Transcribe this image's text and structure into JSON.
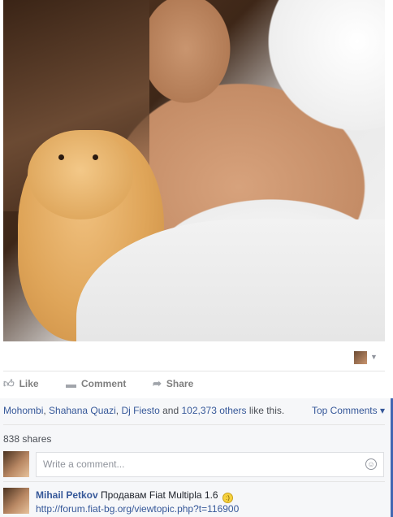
{
  "post": {
    "image_alt": "",
    "actions": {
      "like": "Like",
      "comment": "Comment",
      "share": "Share"
    },
    "icons": {
      "like": "thumbs-up-icon",
      "comment": "speech-bubble-icon",
      "share": "share-arrow-icon"
    }
  },
  "likes": {
    "names": [
      "Mohombi",
      "Shahana Quazi",
      "Dj Fiesto"
    ],
    "sep1": ", ",
    "sep2": " and ",
    "others": "102,373 others",
    "suffix": " like this.",
    "top_comments": "Top Comments ▾"
  },
  "shares": "838 shares",
  "comment_input": {
    "placeholder": "Write a comment..."
  },
  "comment": {
    "author": "Mihail Petkov",
    "text": "Продавам Fiat Multipla 1.6",
    "emoji": ":)",
    "link": "http://forum.fiat-bg.org/viewtopic.php?t=116900"
  },
  "colors": {
    "link": "#365899",
    "muted": "#7f7f7f",
    "panel": "#f6f7f9"
  }
}
